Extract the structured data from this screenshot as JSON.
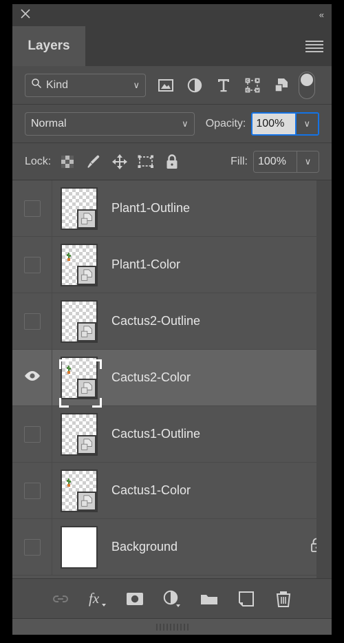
{
  "window": {
    "close_icon": "close-icon",
    "collapse_icon": "«"
  },
  "tab": {
    "label": "Layers",
    "menu_icon": "hamburger-menu-icon"
  },
  "filter": {
    "kind_label": "Kind",
    "search_icon": "search-icon",
    "chevron": "∨",
    "type_icons": [
      "pixel-layer-filter-icon",
      "adjustment-layer-filter-icon",
      "type-layer-filter-icon",
      "shape-layer-filter-icon",
      "smart-object-filter-icon"
    ],
    "toggle_name": "filter-enable-toggle",
    "toggle_state": "off"
  },
  "blend": {
    "mode": "Normal",
    "mode_chevron": "∨",
    "opacity_label": "Opacity:",
    "opacity_value": "100%",
    "opacity_chevron": "∨",
    "opacity_focused": true
  },
  "lock": {
    "label": "Lock:",
    "icons": [
      "lock-transparency-icon",
      "lock-image-pixels-icon",
      "lock-position-icon",
      "lock-artboard-nesting-icon",
      "lock-all-icon"
    ],
    "fill_label": "Fill:",
    "fill_value": "100%",
    "fill_chevron": "∨"
  },
  "layers": [
    {
      "name": "Plant1-Outline",
      "visible": false,
      "selected": false,
      "thumb": "transparent",
      "smart_object": true,
      "has_art": false,
      "locked": false
    },
    {
      "name": "Plant1-Color",
      "visible": false,
      "selected": false,
      "thumb": "transparent",
      "smart_object": true,
      "has_art": true,
      "locked": false
    },
    {
      "name": "Cactus2-Outline",
      "visible": false,
      "selected": false,
      "thumb": "transparent",
      "smart_object": true,
      "has_art": false,
      "locked": false
    },
    {
      "name": "Cactus2-Color",
      "visible": true,
      "selected": true,
      "thumb": "transparent",
      "smart_object": true,
      "has_art": true,
      "locked": false
    },
    {
      "name": "Cactus1-Outline",
      "visible": false,
      "selected": false,
      "thumb": "transparent",
      "smart_object": true,
      "has_art": false,
      "locked": false
    },
    {
      "name": "Cactus1-Color",
      "visible": false,
      "selected": false,
      "thumb": "transparent",
      "smart_object": true,
      "has_art": true,
      "locked": false
    },
    {
      "name": "Background",
      "visible": false,
      "selected": false,
      "thumb": "white",
      "smart_object": false,
      "has_art": false,
      "locked": true
    }
  ],
  "bottom_bar": {
    "buttons": [
      "link-layers-icon",
      "layer-effects-fx-icon",
      "add-layer-mask-icon",
      "new-adjustment-layer-icon",
      "new-group-icon",
      "new-layer-icon",
      "delete-layer-icon"
    ],
    "fx_label": "fx"
  },
  "colors": {
    "panel_bg": "#535353",
    "chrome_bg": "#4d4d4d",
    "titlebar_bg": "#3d3d3d",
    "row_selected": "#646464",
    "focus_blue": "#1473e6",
    "text": "#e2e2e2"
  }
}
